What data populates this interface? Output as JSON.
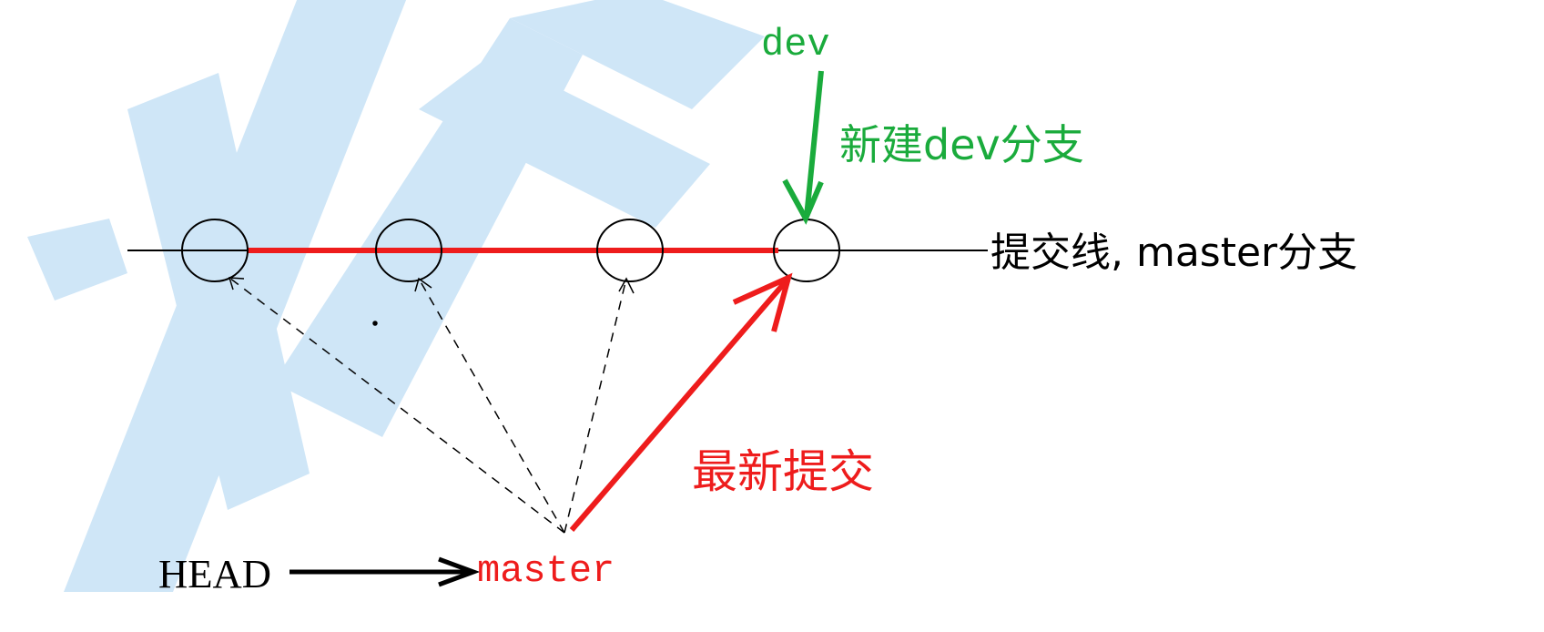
{
  "watermark": {
    "color": "#cfe6f7"
  },
  "labels": {
    "dev_branch": "dev",
    "new_dev_branch": "新建dev分支",
    "commit_line": "提交线, master分支",
    "latest_commit": "最新提交",
    "head": "HEAD",
    "master": "master"
  },
  "colors": {
    "branch_line": "#000000",
    "master_path": "#ee1c1c",
    "dev": "#1aab3c",
    "latest": "#ee1c1c",
    "head": "#000000",
    "master_label": "#ee1c1c"
  },
  "commits": [
    {
      "id": "c1",
      "role": "old"
    },
    {
      "id": "c2",
      "role": "old"
    },
    {
      "id": "c3",
      "role": "old"
    },
    {
      "id": "c4",
      "role": "latest"
    }
  ]
}
